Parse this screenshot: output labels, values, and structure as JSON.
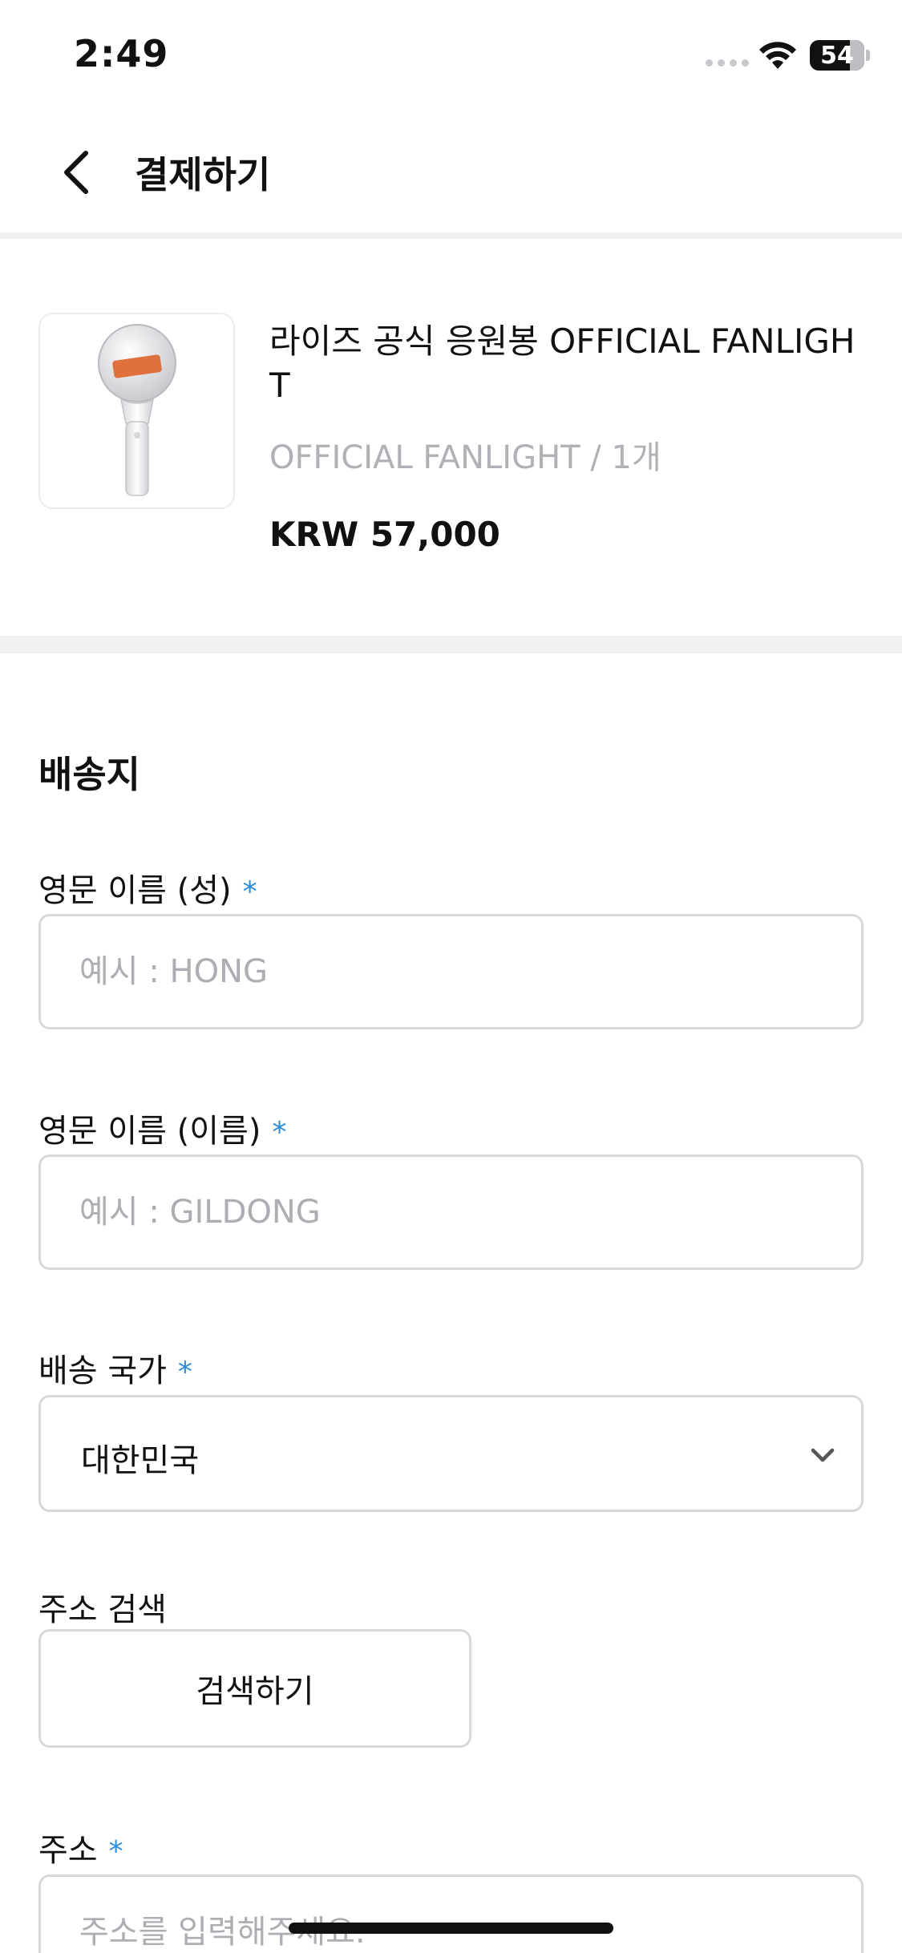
{
  "status_bar": {
    "time": "2:49",
    "battery": "54"
  },
  "header": {
    "title": "결제하기",
    "back_icon": "chevron-left-icon"
  },
  "product": {
    "name": "라이즈 공식 응원봉 OFFICIAL FANLIGHT",
    "option": "OFFICIAL FANLIGHT / 1개",
    "price": "KRW 57,000"
  },
  "shipping": {
    "section_title": "배송지",
    "required_mark": "*",
    "last_name": {
      "label": "영문 이름 (성)",
      "placeholder": "예시 : HONG",
      "value": ""
    },
    "first_name": {
      "label": "영문 이름 (이름)",
      "placeholder": "예시 : GILDONG",
      "value": ""
    },
    "country": {
      "label": "배송 국가",
      "value": "대한민국"
    },
    "address_search": {
      "label": "주소 검색",
      "button_label": "검색하기"
    },
    "address": {
      "label": "주소",
      "placeholder": "주소를 입력해주세요.",
      "value": ""
    }
  },
  "colors": {
    "accent_required": "#2c8bd6",
    "border": "#d8d8dc",
    "muted_text": "#b0b0b6"
  }
}
